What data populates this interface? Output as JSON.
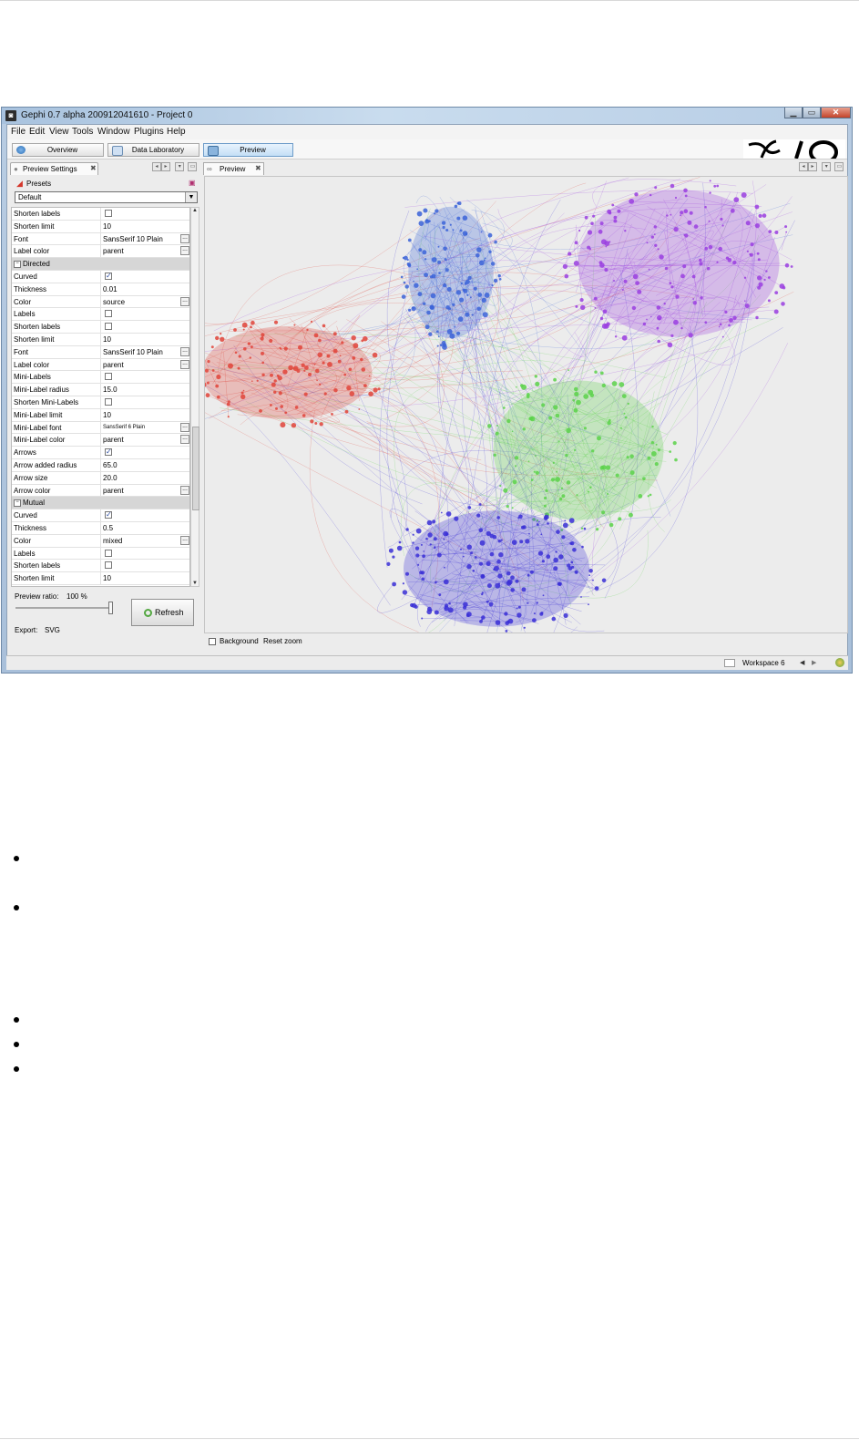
{
  "window": {
    "title": "Gephi 0.7 alpha 200912041610 - Project 0",
    "controls": [
      "minimize",
      "maximize",
      "close"
    ]
  },
  "menu": [
    "File",
    "Edit",
    "View",
    "Tools",
    "Window",
    "Plugins",
    "Help"
  ],
  "toolbar": {
    "overview_label": "Overview",
    "data_laboratory_label": "Data Laboratory",
    "preview_label": "Preview"
  },
  "preview_settings": {
    "tab_label": "Preview Settings",
    "presets_label": "Presets",
    "preset_selected": "Default",
    "rows": [
      {
        "name": "Shorten labels",
        "type": "checkbox",
        "checked": false
      },
      {
        "name": "Shorten limit",
        "type": "text",
        "value": "10"
      },
      {
        "name": "Font",
        "type": "text",
        "value": "SansSerif 10 Plain",
        "button": true
      },
      {
        "name": "Label color",
        "type": "text",
        "value": "parent",
        "button": true
      },
      {
        "name": "Directed",
        "type": "header"
      },
      {
        "name": "Curved",
        "type": "checkbox",
        "checked": true
      },
      {
        "name": "Thickness",
        "type": "text",
        "value": "0.01"
      },
      {
        "name": "Color",
        "type": "text",
        "value": "source",
        "button": true
      },
      {
        "name": "Labels",
        "type": "checkbox",
        "checked": false
      },
      {
        "name": "Shorten labels",
        "type": "checkbox",
        "checked": false
      },
      {
        "name": "Shorten limit",
        "type": "text",
        "value": "10"
      },
      {
        "name": "Font",
        "type": "text",
        "value": "SansSerif 10 Plain",
        "button": true
      },
      {
        "name": "Label color",
        "type": "text",
        "value": "parent",
        "button": true
      },
      {
        "name": "Mini-Labels",
        "type": "checkbox",
        "checked": false
      },
      {
        "name": "Mini-Label radius",
        "type": "text",
        "value": "15.0"
      },
      {
        "name": "Shorten Mini-Labels",
        "type": "checkbox",
        "checked": false
      },
      {
        "name": "Mini-Label limit",
        "type": "text",
        "value": "10"
      },
      {
        "name": "Mini-Label font",
        "type": "text",
        "value": "SansSerif 6 Plain",
        "button": true
      },
      {
        "name": "Mini-Label color",
        "type": "text",
        "value": "parent",
        "button": true
      },
      {
        "name": "Arrows",
        "type": "checkbox",
        "checked": true
      },
      {
        "name": "Arrow added radius",
        "type": "text",
        "value": "65.0"
      },
      {
        "name": "Arrow size",
        "type": "text",
        "value": "20.0"
      },
      {
        "name": "Arrow color",
        "type": "text",
        "value": "parent",
        "button": true
      },
      {
        "name": "Mutual",
        "type": "header"
      },
      {
        "name": "Curved",
        "type": "checkbox",
        "checked": true
      },
      {
        "name": "Thickness",
        "type": "text",
        "value": "0.5"
      },
      {
        "name": "Color",
        "type": "text",
        "value": "mixed",
        "button": true
      },
      {
        "name": "Labels",
        "type": "checkbox",
        "checked": false
      },
      {
        "name": "Shorten labels",
        "type": "checkbox",
        "checked": false
      },
      {
        "name": "Shorten limit",
        "type": "text",
        "value": "10"
      }
    ],
    "preview_ratio_label": "Preview ratio:",
    "preview_ratio_value": "100 %",
    "preview_ratio": 1.0,
    "refresh_label": "Refresh",
    "export_label": "Export:",
    "export_value": "SVG"
  },
  "preview": {
    "tab_label": "Preview",
    "background_label": "Background",
    "background_checked": false,
    "reset_zoom_label": "Reset zoom",
    "clusters": [
      {
        "color": "#9a3ee0",
        "label": "purple"
      },
      {
        "color": "#3b63d8",
        "label": "blue"
      },
      {
        "color": "#e0443a",
        "label": "red"
      },
      {
        "color": "#5cd24a",
        "label": "green"
      },
      {
        "color": "#3a2fd6",
        "label": "indigo"
      }
    ]
  },
  "status_bar": {
    "workspace_label": "Workspace 6"
  },
  "page": {
    "bullet_count": 5
  }
}
